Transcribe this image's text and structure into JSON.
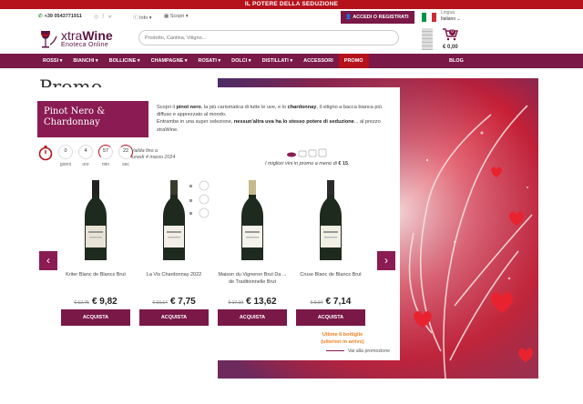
{
  "topbar": {
    "text": "IL POTERE DELLA SEDUZIONE"
  },
  "util": {
    "phone": "+39 0543771911",
    "social_icons": [
      "instagram-icon",
      "facebook-icon",
      "rss-icon"
    ],
    "info_label": "Info ▾",
    "scopri_label": "Scopri ▾",
    "login_label": "ACCEDI O REGISTRATI",
    "lang_title": "Lingua",
    "lang_value": "Italiano",
    "flag_colors": [
      "#009246",
      "#ffffff",
      "#ce2b37"
    ]
  },
  "header": {
    "logo_name_a": "xtra",
    "logo_name_b": "Wine",
    "logo_sub": "Enoteca Online",
    "search_placeholder": "Prodotto, Cantina, Vitigno...",
    "cart_count": "0",
    "cart_total": "€ 0,00"
  },
  "nav": {
    "items": [
      "ROSSI ▾",
      "BIANCHI ▾",
      "BOLLICINE ▾",
      "CHAMPAGNE ▾",
      "ROSATI ▾",
      "DOLCI ▾",
      "DISTILLATI ▾",
      "ACCESSORI",
      "PROMO"
    ],
    "active_index": 8,
    "blog": "BLOG"
  },
  "page": {
    "title": "Promo",
    "label": "Pinot Nero & Chardonnay",
    "desc_1": "Scopri il ",
    "desc_b1": "pinot nero",
    "desc_2": ", la più carismatica di tutte le uve, e lo ",
    "desc_b2": "chardonnay",
    "desc_3": ", il vitigno a bacca bianca più diffuso e apprezzato al mondo.",
    "desc_4": "Entrambe in una super selezione, ",
    "desc_b3": "nessun'altra uva ha lo stesso potere di seduzione",
    "desc_5": "... al prezzo xtraWine.",
    "timer": [
      {
        "value": "",
        "label": ""
      },
      {
        "value": "0",
        "label": "giorni"
      },
      {
        "value": "4",
        "label": "ore"
      },
      {
        "value": "57",
        "label": "min"
      },
      {
        "value": "22",
        "label": "sec"
      }
    ],
    "valid_1": "Valida fino a",
    "valid_2": "lunedì 4 marzo 2024",
    "best_text": "I migliori vini in promo a meno di ",
    "best_price": "€ 15",
    "best_end": ".",
    "stock_1": "Ultime 6 bottiglie",
    "stock_2": "(ulteriori in arrivo)",
    "see_all": "Vai alla promozione",
    "arrow_left": "‹",
    "arrow_right": "›"
  },
  "products": [
    {
      "name": "Kriter Blanc de Blancs Brut",
      "old": "€ 12,75",
      "price": "€ 9,82",
      "buy": "ACQUISTA",
      "label_color": "#e9e3d6",
      "neck": "#222222"
    },
    {
      "name": "La Vis Chardonnay 2022",
      "old": "€ 10,14",
      "price": "€ 7,75",
      "buy": "ACQUISTA",
      "label_color": "#f3efe6",
      "neck": "#3b3b2e"
    },
    {
      "name": "Maison du Vigneron Brut Da ... de Traditionnelle Brut",
      "old": "€ 17,10",
      "price": "€ 13,62",
      "buy": "ACQUISTA",
      "label_color": "#f4f2ea",
      "neck": "#c6b98a"
    },
    {
      "name": "Cruse Blanc de Blancs Brut",
      "old": "€ 9,64",
      "price": "€ 7,14",
      "buy": "ACQUISTA",
      "label_color": "#f2efe4",
      "neck": "#2b2b2b"
    }
  ]
}
